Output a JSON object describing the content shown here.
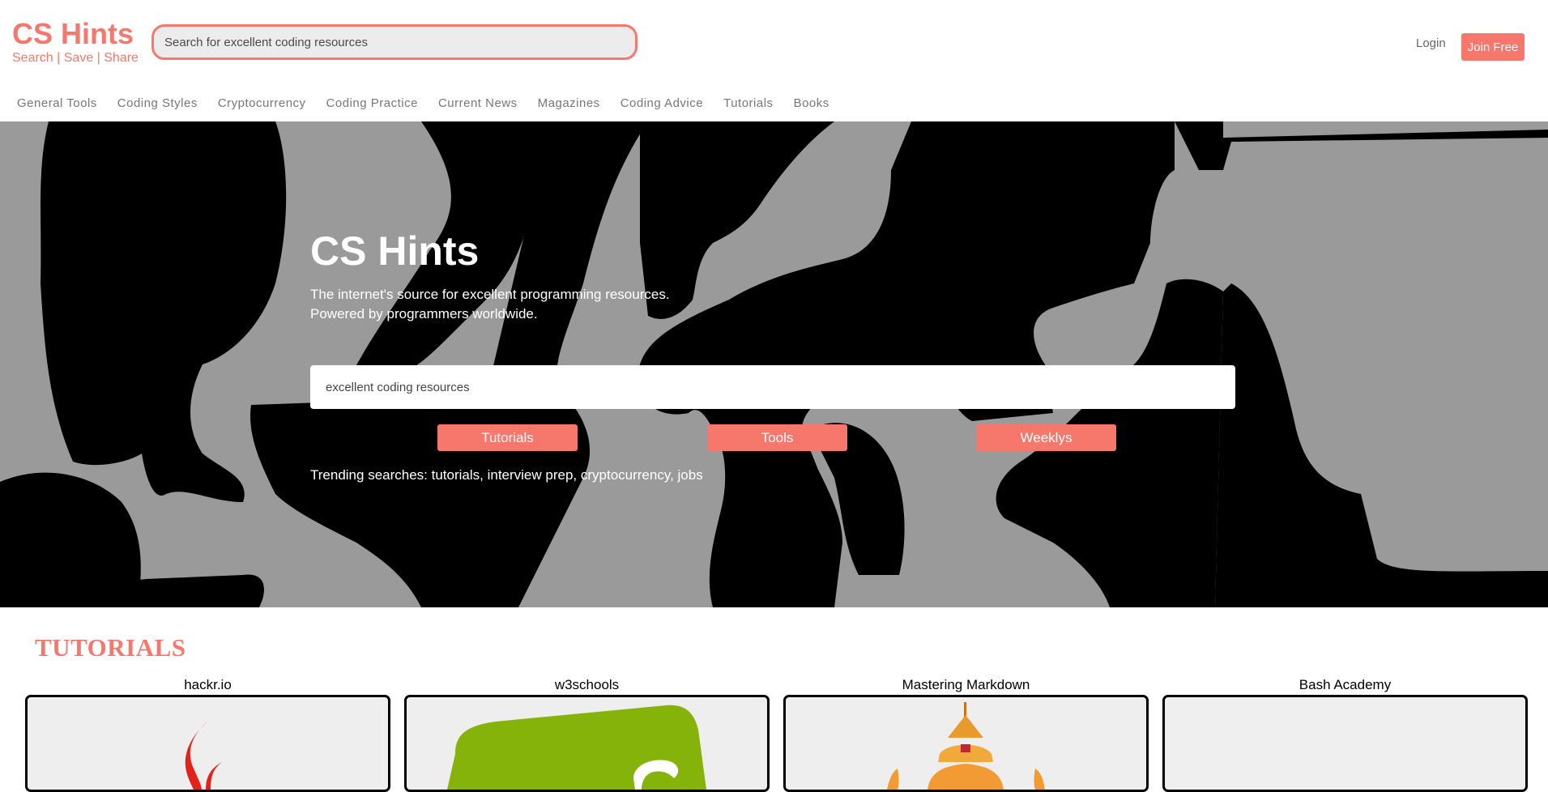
{
  "brand": {
    "title": "CS Hints",
    "tagline": "Search | Save | Share"
  },
  "header": {
    "search_placeholder": "Search for excellent coding resources",
    "login_label": "Login",
    "join_label": "Join Free"
  },
  "nav": {
    "items": [
      {
        "label": "General Tools"
      },
      {
        "label": "Coding Styles"
      },
      {
        "label": "Cryptocurrency"
      },
      {
        "label": "Coding Practice"
      },
      {
        "label": "Current News"
      },
      {
        "label": "Magazines"
      },
      {
        "label": "Coding Advice"
      },
      {
        "label": "Tutorials"
      },
      {
        "label": "Books"
      }
    ]
  },
  "hero": {
    "title": "CS Hints",
    "subtitle_line1": "The internet's source for excellent programming resources.",
    "subtitle_line2": "Powered by programmers worldwide.",
    "search_value": "excellent coding resources",
    "buttons": [
      {
        "label": "Tutorials"
      },
      {
        "label": "Tools"
      },
      {
        "label": "Weeklys"
      }
    ],
    "trending": "Trending searches: tutorials, interview prep, cryptocurrency, jobs"
  },
  "tutorials": {
    "heading": "TUTORIALS",
    "cards": [
      {
        "title": "hackr.io"
      },
      {
        "title": "w3schools"
      },
      {
        "title": "Mastering Markdown"
      },
      {
        "title": "Bash Academy"
      }
    ]
  },
  "colors": {
    "accent": "#f6776c",
    "hero_bg": "#9a9a9a"
  }
}
